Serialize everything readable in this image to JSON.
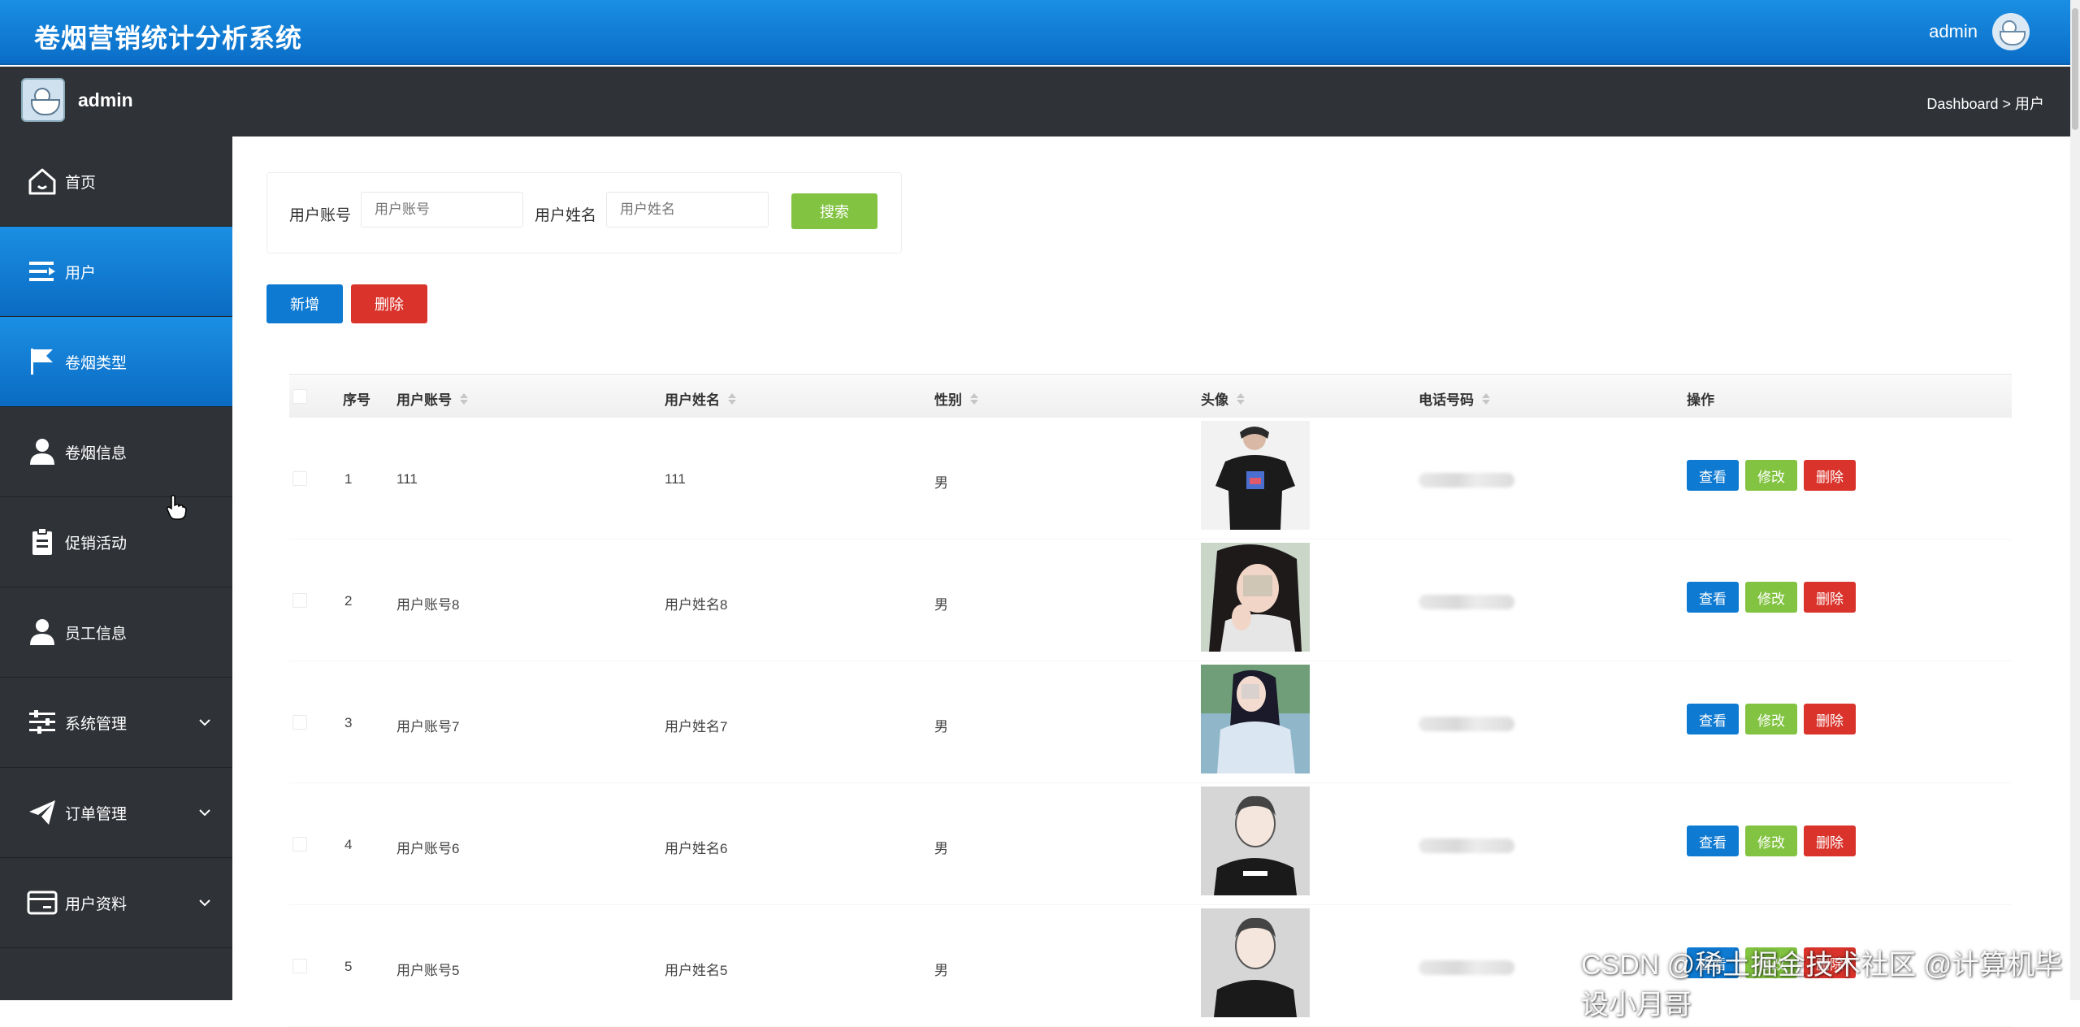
{
  "app": {
    "title": "卷烟营销统计分析系统",
    "user": "admin"
  },
  "subbar": {
    "user": "admin",
    "breadcrumb": "Dashboard > 用户"
  },
  "sidebar": {
    "items": [
      {
        "label": "首页",
        "icon": "home-icon"
      },
      {
        "label": "用户",
        "icon": "menu-icon",
        "active": true
      },
      {
        "label": "卷烟类型",
        "icon": "flag-icon",
        "active": true
      },
      {
        "label": "卷烟信息",
        "icon": "person-icon"
      },
      {
        "label": "促销活动",
        "icon": "clipboard-icon"
      },
      {
        "label": "员工信息",
        "icon": "person-icon"
      },
      {
        "label": "系统管理",
        "icon": "sliders-icon"
      },
      {
        "label": "订单管理",
        "icon": "paper-plane-icon"
      },
      {
        "label": "用户资料",
        "icon": "card-icon"
      }
    ]
  },
  "search": {
    "account_label": "用户账号",
    "account_placeholder": "用户账号",
    "name_label": "用户姓名",
    "name_placeholder": "用户姓名",
    "search_button": "搜索"
  },
  "actions": {
    "add": "新增",
    "delete": "删除"
  },
  "table": {
    "headers": [
      "序号",
      "用户账号",
      "用户姓名",
      "性别",
      "头像",
      "电话号码",
      "操作"
    ],
    "rows": [
      {
        "no": "1",
        "account": "111",
        "name": "111",
        "gender": "男"
      },
      {
        "no": "2",
        "account": "用户账号8",
        "name": "用户姓名8",
        "gender": "男"
      },
      {
        "no": "3",
        "account": "用户账号7",
        "name": "用户姓名7",
        "gender": "男"
      },
      {
        "no": "4",
        "account": "用户账号6",
        "name": "用户姓名6",
        "gender": "男"
      },
      {
        "no": "5",
        "account": "用户账号5",
        "name": "用户姓名5",
        "gender": "男"
      }
    ],
    "row_buttons": {
      "view": "查看",
      "edit": "修改",
      "delete": "删除"
    }
  },
  "watermark": "CSDN @稀土掘金技术社区 @计算机毕设小月哥"
}
